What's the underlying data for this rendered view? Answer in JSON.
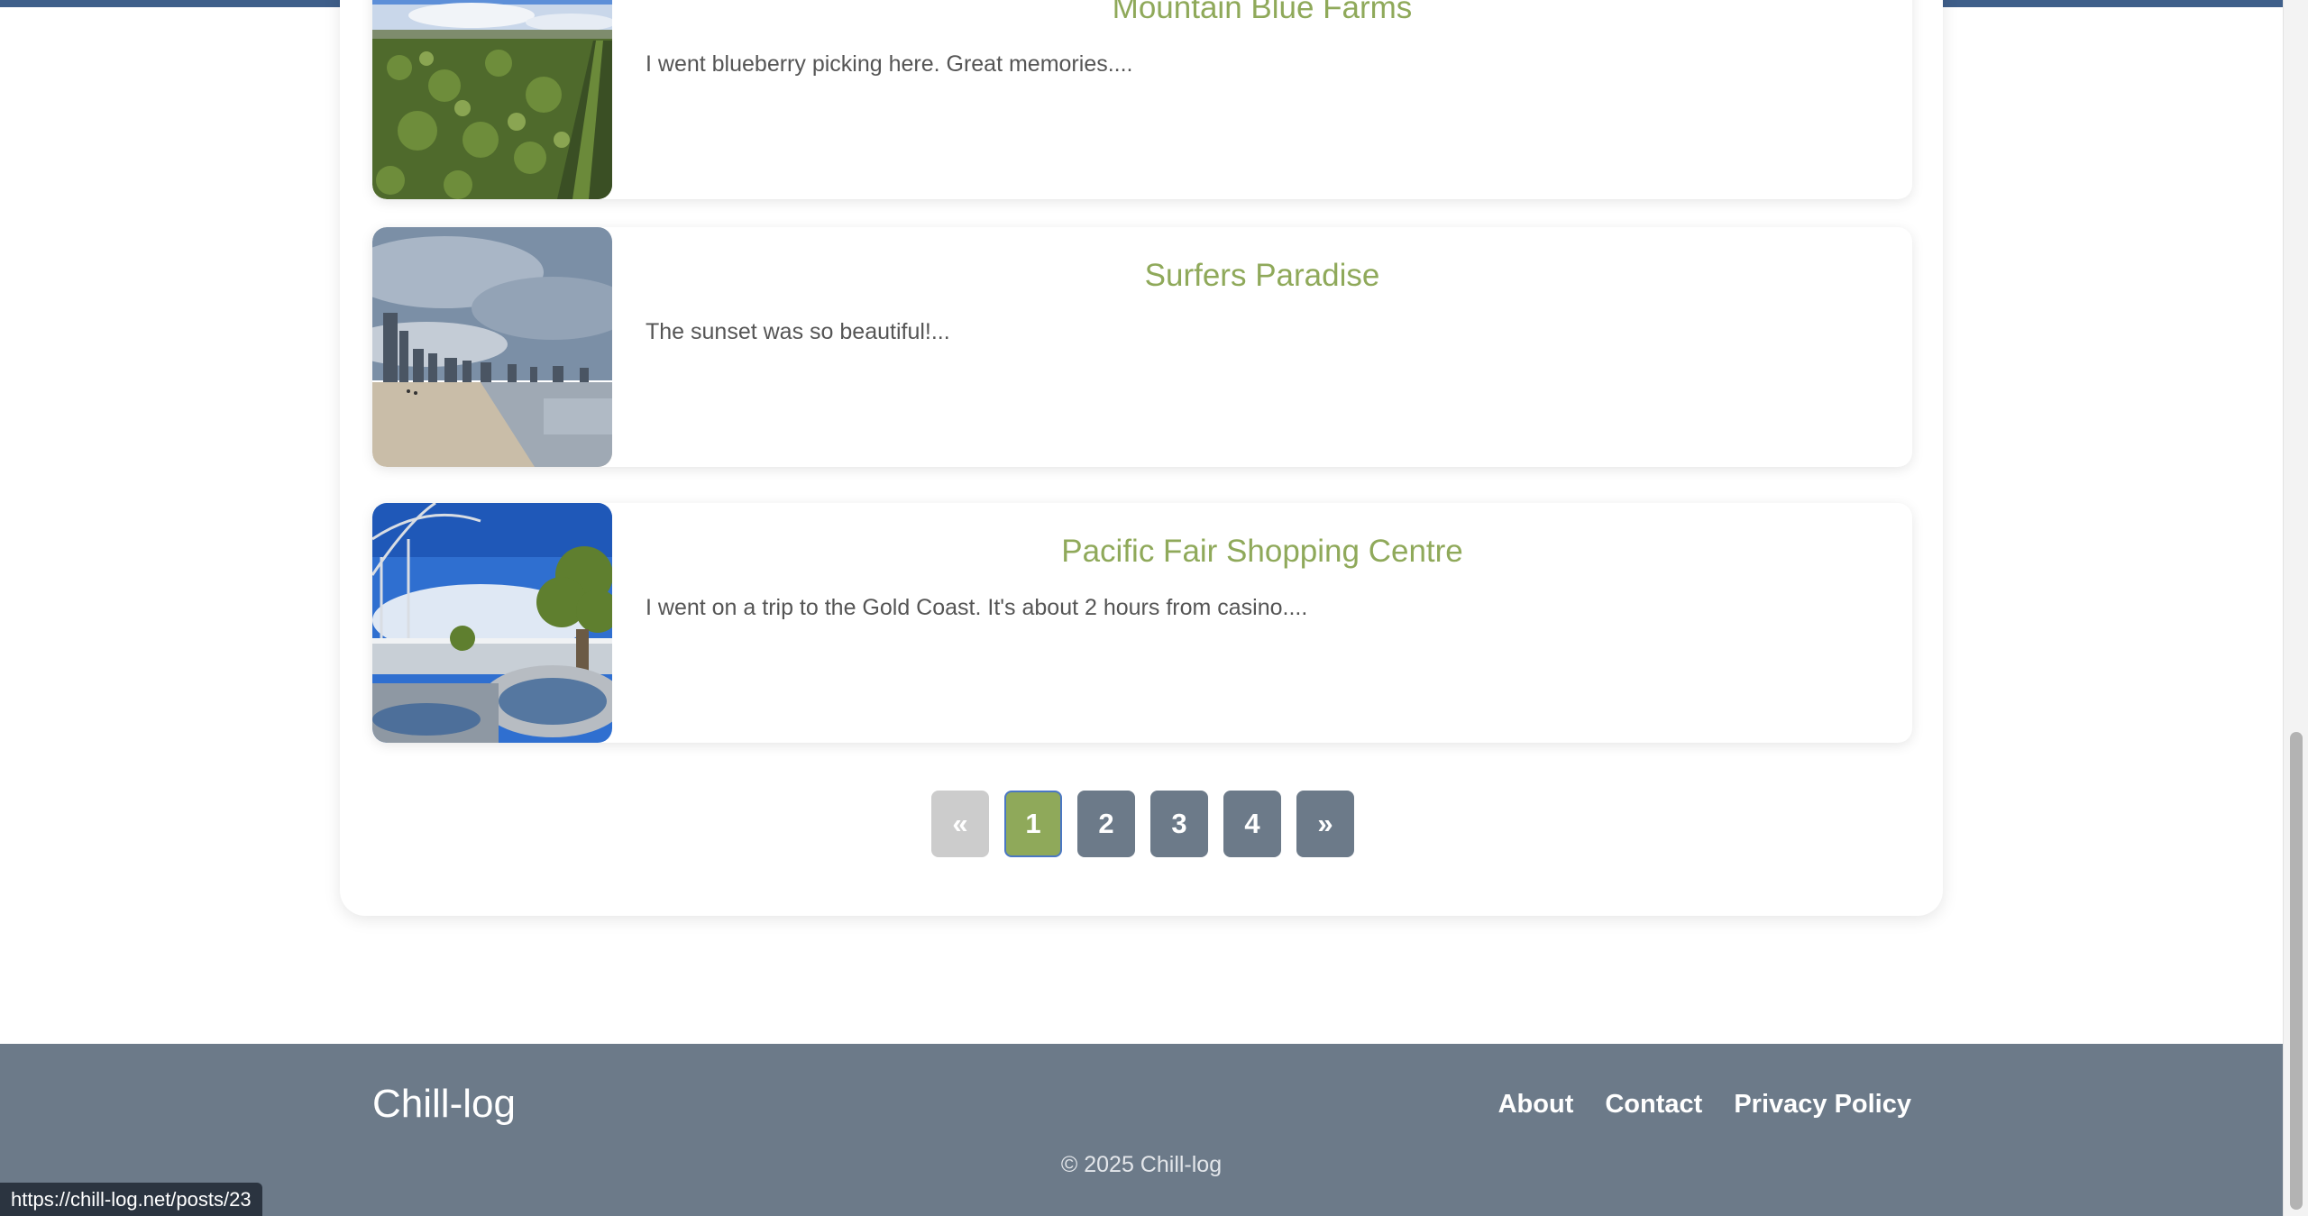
{
  "posts": [
    {
      "title": "Mountain Blue Farms",
      "excerpt": "I went blueberry picking here. Great memories....",
      "image": "blueberry-farm-photo"
    },
    {
      "title": "Surfers Paradise",
      "excerpt": "The sunset was so beautiful!...",
      "image": "beach-skyline-photo"
    },
    {
      "title": "Pacific Fair Shopping Centre",
      "excerpt": "I went on a trip to the Gold Coast. It's about 2 hours from casino....",
      "image": "shopping-centre-photo"
    }
  ],
  "pagination": {
    "prev": "«",
    "pages": [
      "1",
      "2",
      "3",
      "4"
    ],
    "current": "1",
    "next": "»"
  },
  "footer": {
    "brand": "Chill-log",
    "links": [
      "About",
      "Contact",
      "Privacy Policy"
    ],
    "copyright": "© 2025 Chill-log"
  },
  "status_bar": {
    "url": "https://chill-log.net/posts/23"
  },
  "colors": {
    "accent": "#8fa95a",
    "slate": "#6c7a89",
    "text": "#555555"
  }
}
